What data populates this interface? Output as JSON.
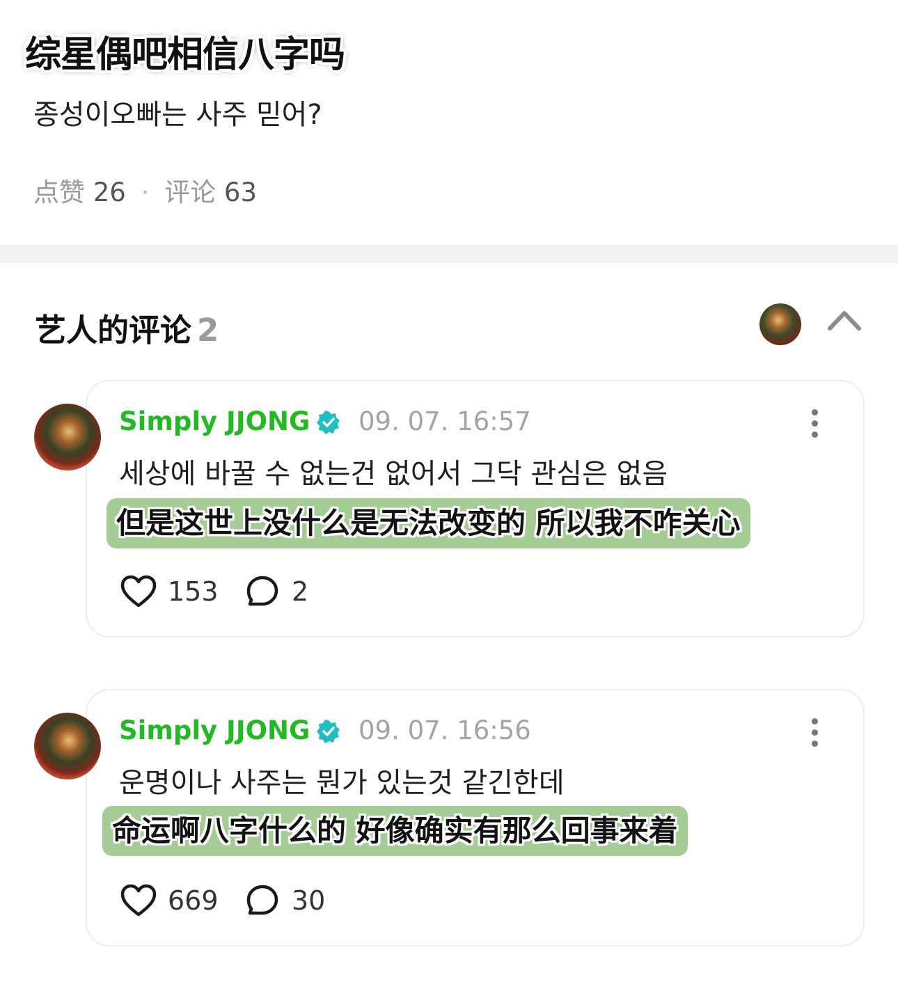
{
  "post": {
    "subtitle_overlay": "综星偶吧相信八字吗",
    "body": "종성이오빠는 사주 믿어?",
    "likes_label": "点赞",
    "likes_count": "26",
    "comments_label": "评论",
    "comments_count": "63"
  },
  "artist_comments": {
    "title": "艺人的评论",
    "count": "2"
  },
  "comments": [
    {
      "author": "Simply JJONG",
      "time": "09. 07. 16:57",
      "text": "세상에 바꿀 수 없는건 없어서 그닥 관심은 없음",
      "subtitle": "但是这世上没什么是无法改变的 所以我不咋关心",
      "likes": "153",
      "replies": "2"
    },
    {
      "author": "Simply JJONG",
      "time": "09. 07. 16:56",
      "text": "운명이나 사주는 뭔가 있는것 같긴한데",
      "subtitle": "命运啊八字什么的 好像确实有那么回事来着",
      "likes": "669",
      "replies": "30"
    }
  ],
  "colors": {
    "author_green": "#23b923",
    "verified_teal": "#1fbfbf",
    "subtitle_highlight": "#a6cc96"
  },
  "icons": [
    "heart-icon",
    "comment-bubble-icon",
    "verified-badge-icon",
    "more-vertical-icon",
    "chevron-up-icon"
  ]
}
